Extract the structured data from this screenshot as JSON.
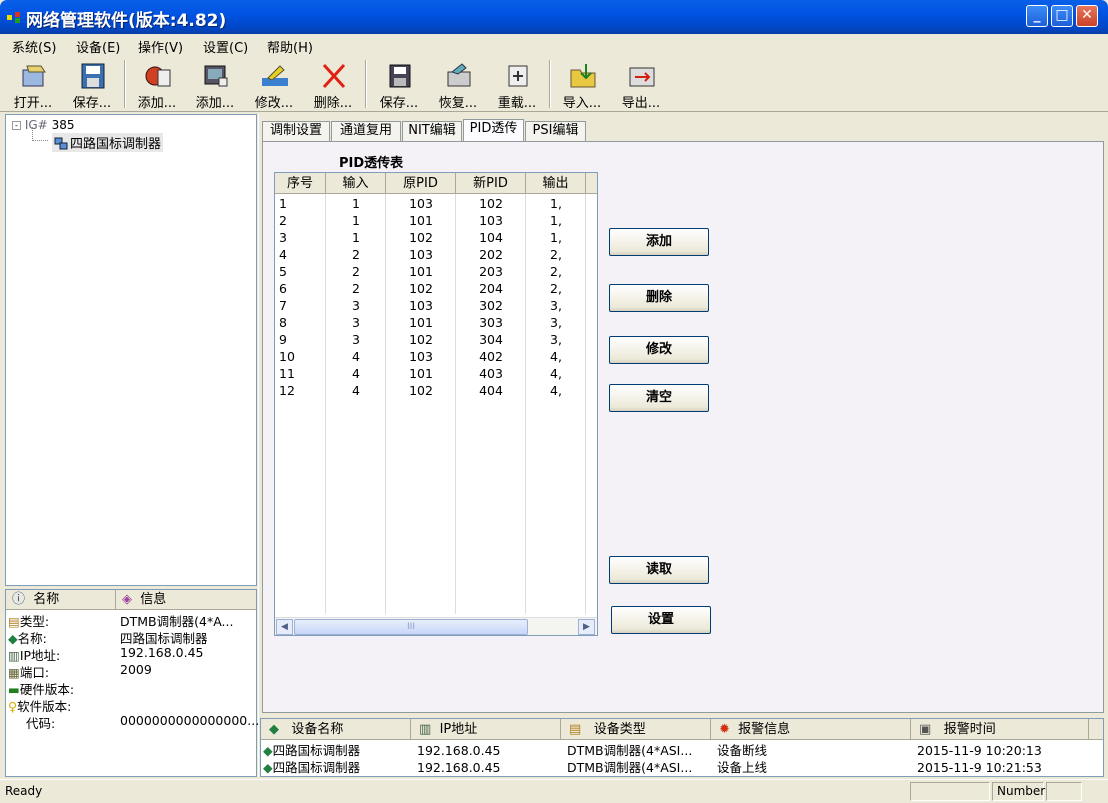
{
  "window": {
    "title": "网络管理软件(版本:4.82)"
  },
  "menu": [
    "系统(S)",
    "设备(E)",
    "操作(V)",
    "设置(C)",
    "帮助(H)"
  ],
  "toolbar": {
    "open": "打开...",
    "save": "保存...",
    "add1": "添加...",
    "add2": "添加...",
    "modify": "修改...",
    "delete": "删除...",
    "save2": "保存...",
    "restore": "恢复...",
    "reload": "重载...",
    "import": "导入...",
    "export": "导出..."
  },
  "tree": {
    "root": "385",
    "node": "四路国标调制器"
  },
  "info": {
    "header": {
      "name": "名称",
      "info": "信息"
    },
    "rows": [
      {
        "key": "类型:",
        "value": "DTMB调制器(4*A..."
      },
      {
        "key": "名称:",
        "value": "四路国标调制器"
      },
      {
        "key": "IP地址:",
        "value": "192.168.0.45"
      },
      {
        "key": "端口:",
        "value": "2009"
      },
      {
        "key": "硬件版本:",
        "value": ""
      },
      {
        "key": "软件版本:",
        "value": ""
      },
      {
        "key": "代码:",
        "value": "0000000000000000..."
      }
    ]
  },
  "tabs": [
    "调制设置",
    "通道复用",
    "NIT编辑",
    "PID透传",
    "PSI编辑"
  ],
  "pid_table": {
    "title": "PID透传表",
    "headers": [
      "序号",
      "输入",
      "原PID",
      "新PID",
      "输出"
    ],
    "rows": [
      [
        "1",
        "1",
        "103",
        "102",
        "1,"
      ],
      [
        "2",
        "1",
        "101",
        "103",
        "1,"
      ],
      [
        "3",
        "1",
        "102",
        "104",
        "1,"
      ],
      [
        "4",
        "2",
        "103",
        "202",
        "2,"
      ],
      [
        "5",
        "2",
        "101",
        "203",
        "2,"
      ],
      [
        "6",
        "2",
        "102",
        "204",
        "2,"
      ],
      [
        "7",
        "3",
        "103",
        "302",
        "3,"
      ],
      [
        "8",
        "3",
        "101",
        "303",
        "3,"
      ],
      [
        "9",
        "3",
        "102",
        "304",
        "3,"
      ],
      [
        "10",
        "4",
        "103",
        "402",
        "4,"
      ],
      [
        "11",
        "4",
        "101",
        "403",
        "4,"
      ],
      [
        "12",
        "4",
        "102",
        "404",
        "4,"
      ]
    ],
    "scroll_thumb": "III"
  },
  "buttons": {
    "add": "添加",
    "delete": "删除",
    "modify": "修改",
    "clear": "清空",
    "read": "读取",
    "set": "设置"
  },
  "alarms": {
    "headers": [
      "设备名称",
      "IP地址",
      "设备类型",
      "报警信息",
      "报警时间"
    ],
    "rows": [
      [
        "四路国标调制器",
        "192.168.0.45",
        "DTMB调制器(4*ASI...",
        "设备断线",
        "2015-11-9 10:20:13"
      ],
      [
        "四路国标调制器",
        "192.168.0.45",
        "DTMB调制器(4*ASI...",
        "设备上线",
        "2015-11-9 10:21:53"
      ]
    ]
  },
  "status": {
    "text": "Ready",
    "mode": "Number"
  }
}
